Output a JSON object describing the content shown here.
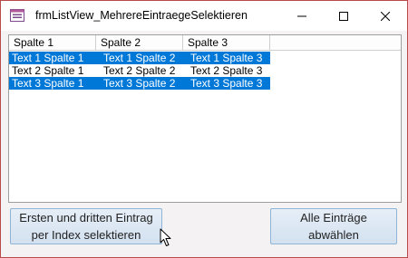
{
  "window": {
    "title": "frmListView_MehrereEintraegeSelektieren"
  },
  "listview": {
    "columns": [
      "Spalte 1",
      "Spalte 2",
      "Spalte 3"
    ],
    "rows": [
      {
        "cells": [
          "Text 1 Spalte 1",
          "Text 1 Spalte 2",
          "Text 1 Spalte 3"
        ],
        "selected": true
      },
      {
        "cells": [
          "Text 2 Spalte 1",
          "Text 2 Spalte 2",
          "Text 2 Spalte 3"
        ],
        "selected": false
      },
      {
        "cells": [
          "Text 3 Spalte 1",
          "Text 3 Spalte 2",
          "Text 3 Spalte 3"
        ],
        "selected": true
      }
    ]
  },
  "buttons": {
    "select_first_third": {
      "line1": "Ersten und dritten Eintrag",
      "line2": "per Index selektieren"
    },
    "deselect_all": {
      "line1": "Alle Einträge",
      "line2": "abwählen"
    }
  },
  "colors": {
    "selection": "#0078d7",
    "window_border": "#b94a4a",
    "button_border": "#8eb4d8"
  },
  "icons": [
    "form-icon",
    "minimize-icon",
    "maximize-icon",
    "close-icon",
    "mouse-cursor-icon"
  ]
}
